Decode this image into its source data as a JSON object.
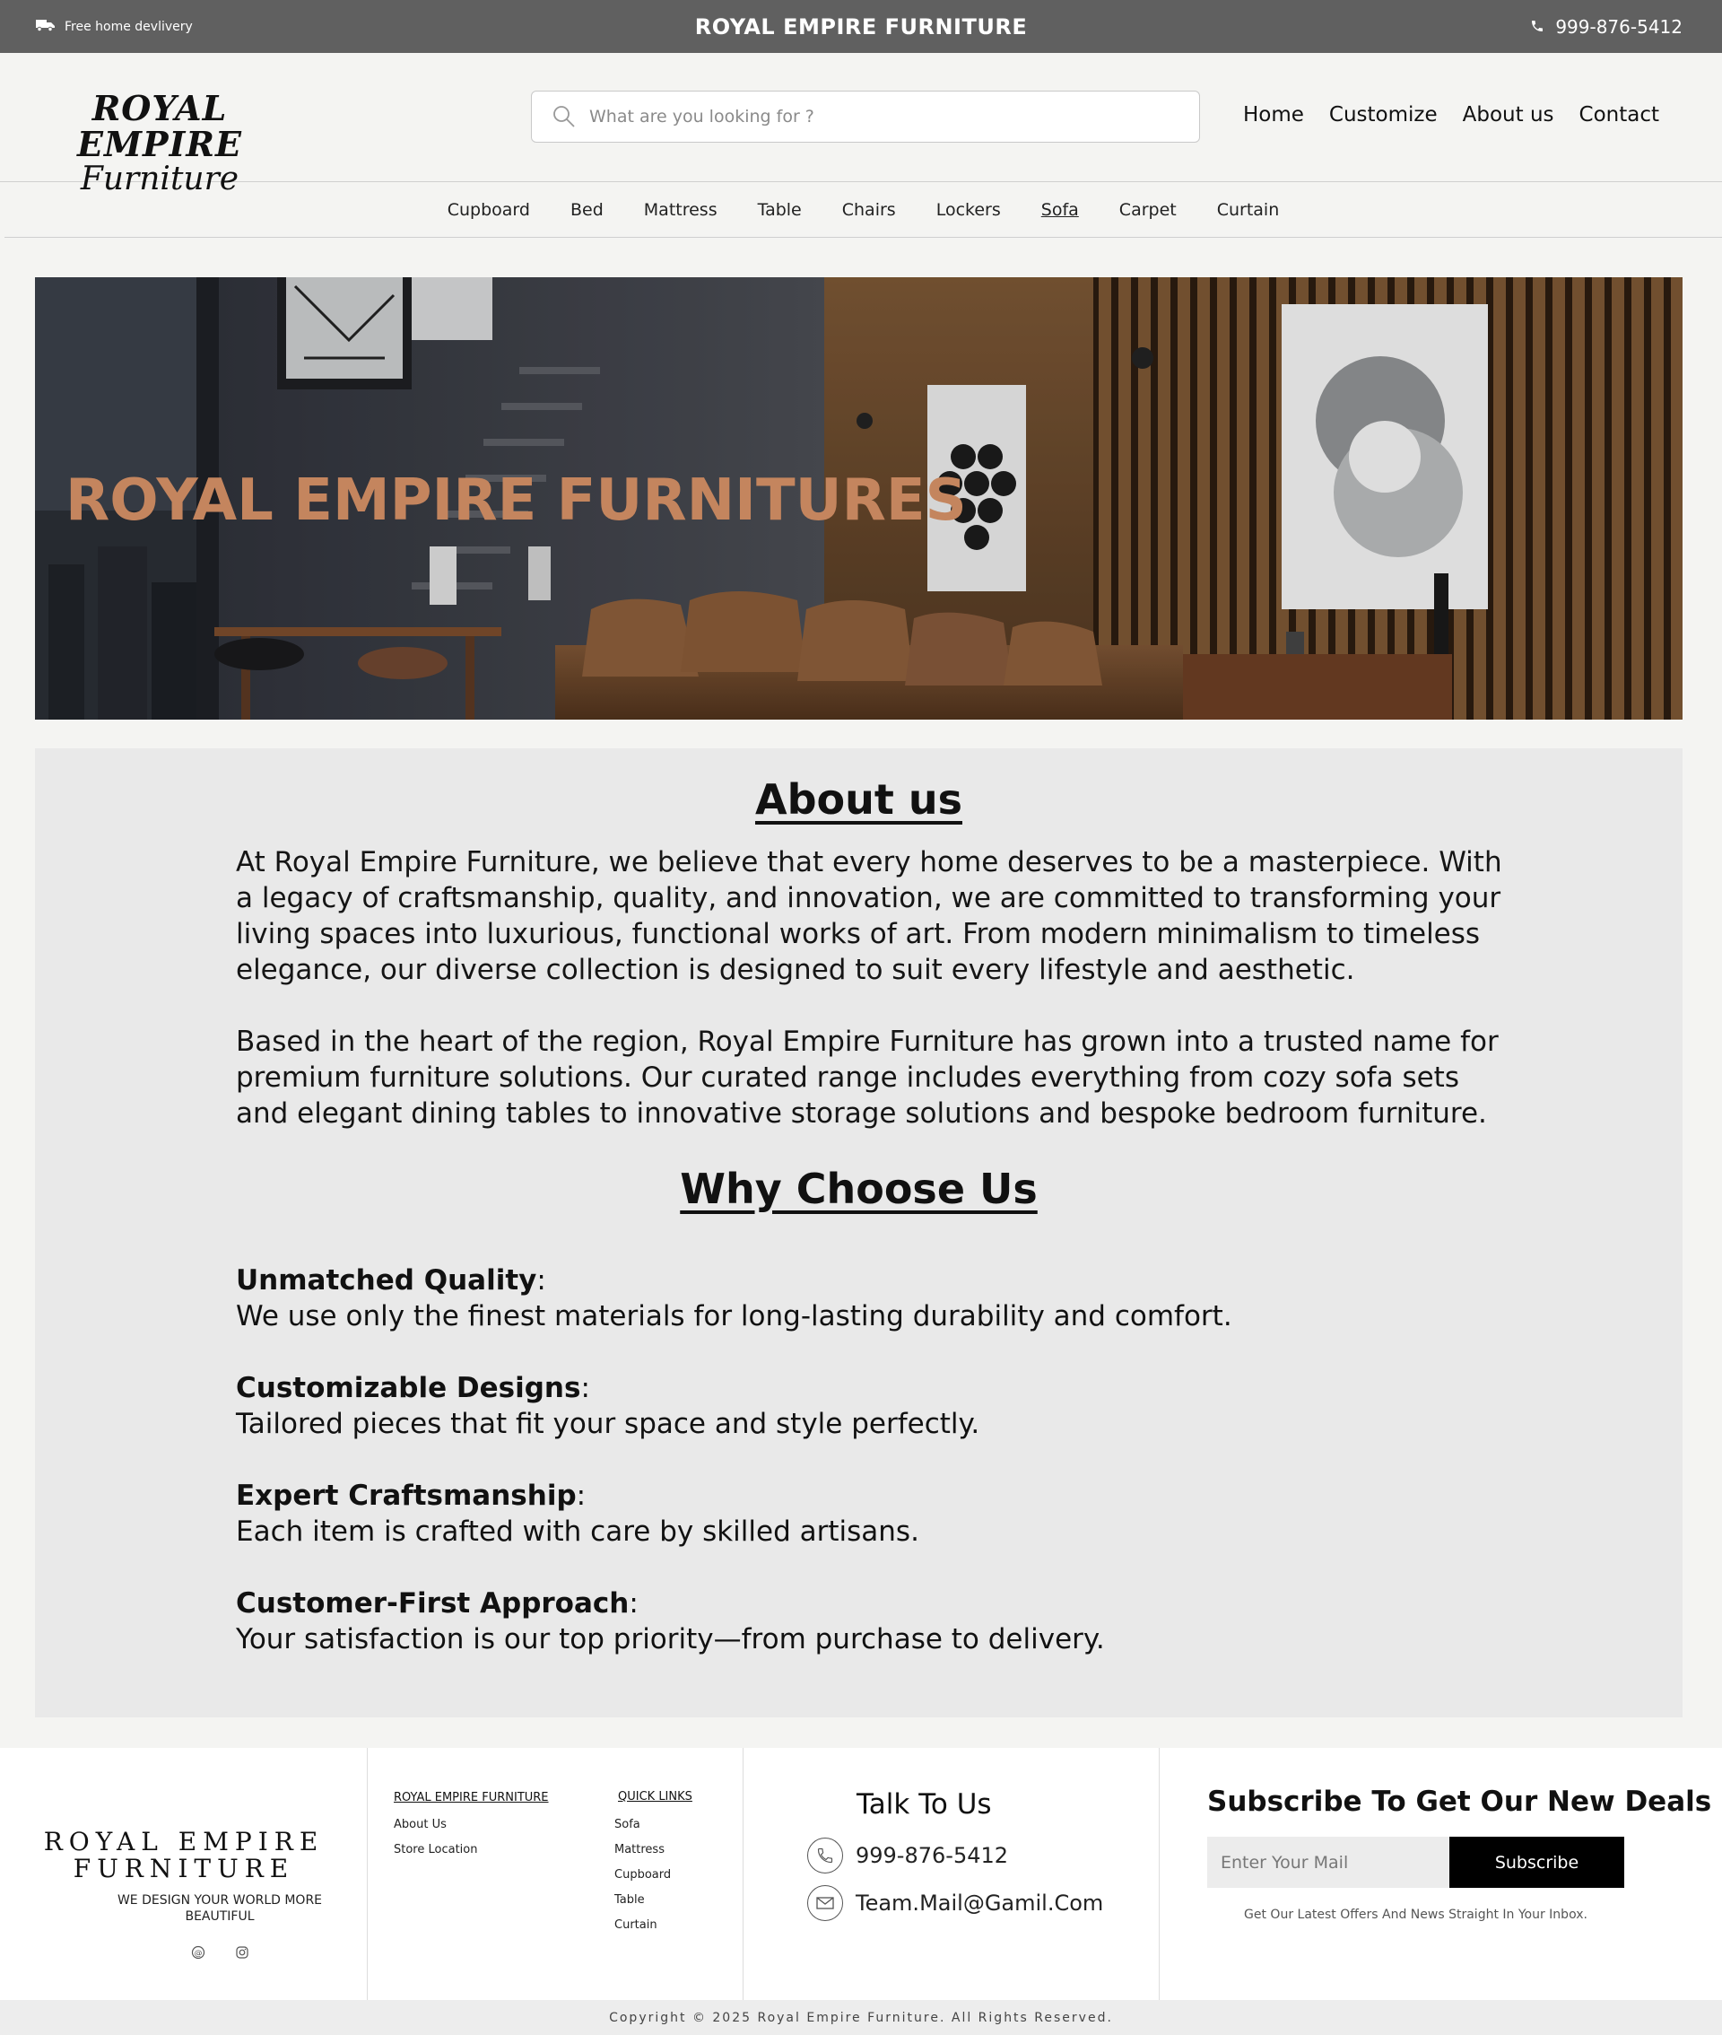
{
  "topbar": {
    "delivery_text": "Free home devlivery",
    "brand_text": "ROYAL EMPIRE  FURNITURE",
    "phone": "999-876-5412"
  },
  "header": {
    "logo_line1": "ROYAL EMPIRE",
    "logo_line2": "Furniture",
    "search_placeholder": "What are you looking for ?",
    "nav": [
      "Home",
      "Customize",
      "About us",
      "Contact"
    ]
  },
  "categories": [
    "Cupboard",
    "Bed",
    "Mattress",
    "Table",
    "Chairs",
    "Lockers",
    "Sofa",
    "Carpet",
    "Curtain"
  ],
  "active_category": "Sofa",
  "hero": {
    "title": "ROYAL EMPIRE FURNITURES"
  },
  "about": {
    "heading": "About us",
    "para1": "At Royal Empire Furniture, we believe that every home deserves to be a masterpiece. With a legacy of craftsmanship, quality, and innovation, we are committed to transforming your living spaces into luxurious, functional works of art. From modern minimalism to timeless elegance, our diverse collection is designed to suit every lifestyle and aesthetic.",
    "para2": "Based in the heart of the region, Royal Empire Furniture has grown into a trusted name for premium furniture solutions. Our curated range includes everything from cozy sofa sets and elegant dining tables to innovative storage solutions and bespoke bedroom furniture."
  },
  "why": {
    "heading": "Why Choose Us",
    "items": [
      {
        "title": "Unmatched Quality",
        "text": "We use only the finest materials for long-lasting durability and comfort."
      },
      {
        "title": "Customizable Designs",
        "text": "Tailored pieces that fit your space and style perfectly."
      },
      {
        "title": "Expert Craftsmanship",
        "text": "Each item is crafted with care by skilled artisans."
      },
      {
        "title": "Customer-First Approach",
        "text": "Your satisfaction is our top priority—from purchase to delivery."
      }
    ]
  },
  "footer": {
    "logo_line1": "ROYAL EMPIRE",
    "logo_line2": "FURNITURE",
    "tagline": "WE DESIGN YOUR WORLD MORE BEAUTIFUL",
    "col1_heading": "ROYAL EMPIRE FURNITURE",
    "col1_links": [
      "About Us",
      "Store Location"
    ],
    "col2_heading": "QUICK LINKS",
    "col2_links": [
      "Sofa",
      "Mattress",
      "Cupboard",
      "Table",
      "Curtain"
    ],
    "talk_heading": "Talk To Us",
    "phone": "999-876-5412",
    "email": "Team.Mail@Gamil.Com",
    "subscribe_heading": "Subscribe To Get Our New Deals",
    "subscribe_placeholder": "Enter Your Mail",
    "subscribe_button": "Subscribe",
    "subscribe_note": "Get Our Latest Offers And News Straight In Your Inbox."
  },
  "copyright": "Copyright © 2025 Royal Empire Furniture. All Rights Reserved.",
  "colors": {
    "topbar": "#606060",
    "hero_title": "#c4855e",
    "content_bg": "#e9e9e9"
  }
}
